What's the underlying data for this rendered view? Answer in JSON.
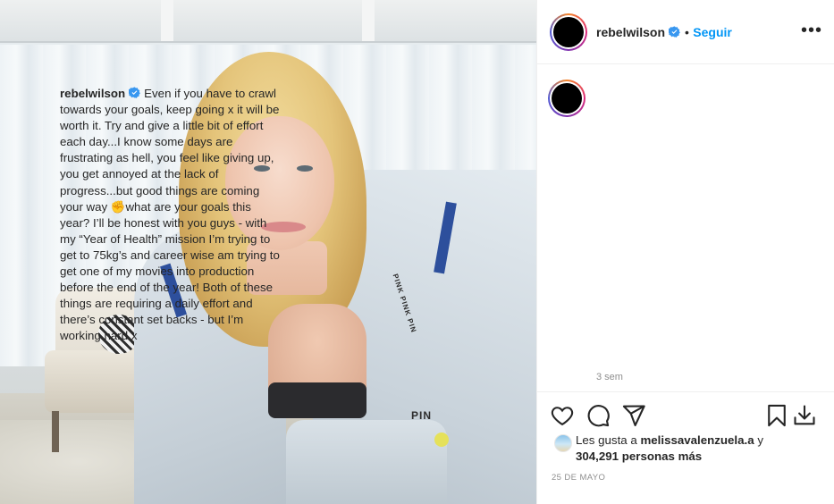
{
  "post": {
    "username": "rebelwilson",
    "follow_label": "Seguir",
    "separator": "•",
    "more_label": "•••",
    "caption": "Even if you have to crawl towards your goals, keep going x it will be worth it. Try and give a little bit of effort each day...I know some days are frustrating as hell, you feel like giving up, you get annoyed at the lack of progress...but good things are coming your way ✊what are your goals this year? I’ll be honest with you guys - with my “Year of Health” mission I’m trying to get to 75kg’s and career wise am trying to get one of my movies into production before the end of the year! Both of these things are requiring a daily effort and there’s constant set backs - but I’m working hard x",
    "caption_time": "3 sem",
    "likes_prefix": "Les gusta a",
    "likes_user": "melissavalenzuela.a",
    "likes_connector": "y",
    "likes_count": "304,291 personas más",
    "date": "25 DE MAYO",
    "photo_text_1": "PINK PINK PIN",
    "photo_text_2": "PIN"
  },
  "icons": {
    "verified": "verified-badge-icon",
    "like": "heart-icon",
    "comment": "comment-bubble-icon",
    "share": "paper-plane-icon",
    "save": "bookmark-icon",
    "download": "download-icon",
    "more": "more-options-icon"
  },
  "colors": {
    "accent": "#0095f6",
    "verified": "#3897f0",
    "text": "#262626",
    "muted": "#8e8e8e",
    "border": "#efefef"
  }
}
